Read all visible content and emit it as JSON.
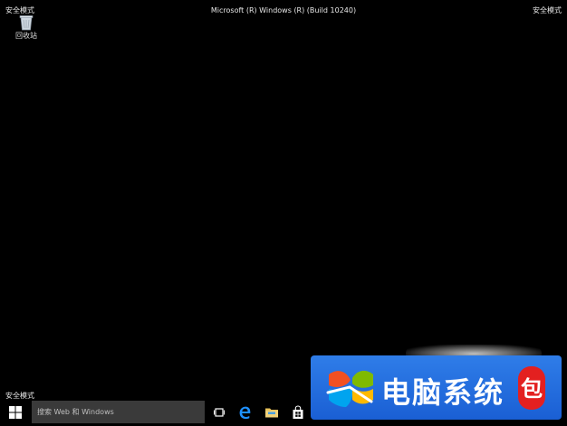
{
  "window": {
    "title": "Microsoft (R) Windows (R) (Build 10240)"
  },
  "safe_mode": {
    "top_left": "安全模式",
    "top_right": "安全模式",
    "bottom_left": "安全模式"
  },
  "desktop": {
    "icons": [
      {
        "label": "回收站",
        "icon": "recycle-bin-icon"
      }
    ]
  },
  "taskbar": {
    "start_icon": "windows-logo-icon",
    "search_placeholder": "搜索 Web 和 Windows",
    "pinned": [
      {
        "name": "task-view",
        "icon": "task-view-icon"
      },
      {
        "name": "edge",
        "icon": "edge-icon"
      },
      {
        "name": "file-explorer",
        "icon": "folder-icon"
      },
      {
        "name": "store",
        "icon": "store-icon"
      }
    ]
  },
  "watermark": {
    "text": "电脑系统",
    "badge_text": "包",
    "background": "#2f7de8",
    "badge_color": "#e32020"
  },
  "colors": {
    "desktop_background": "#000000",
    "search_box": "#3a3a3a",
    "edge_blue": "#1e90ff",
    "store_bag": "#ffffff"
  }
}
